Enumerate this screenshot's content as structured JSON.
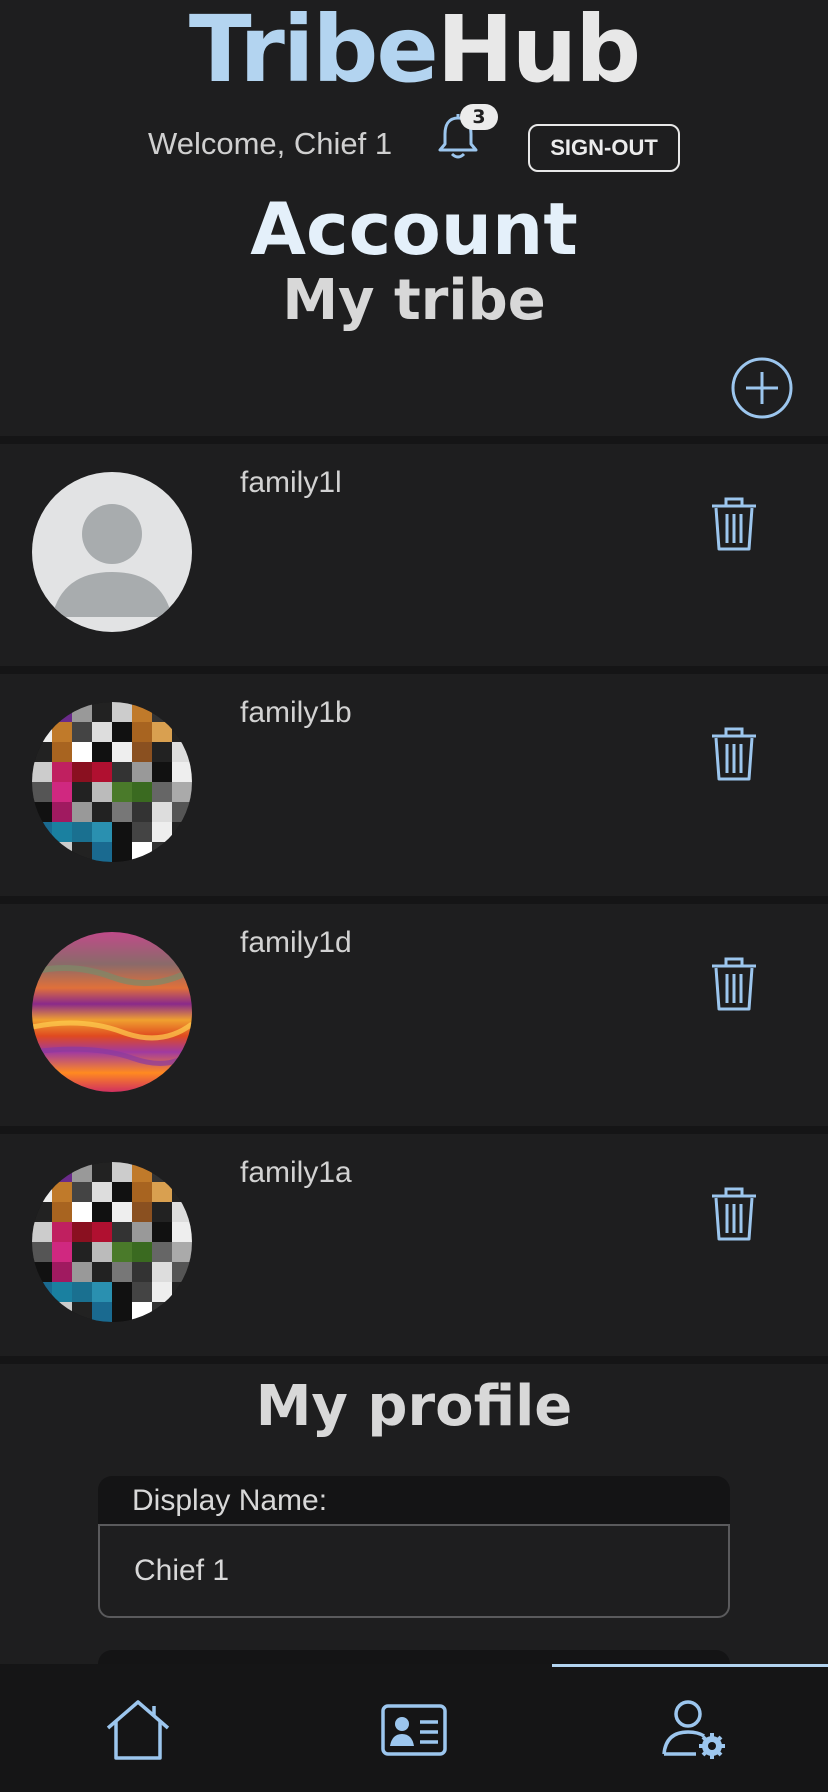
{
  "app": {
    "title_part1": "Tribe",
    "title_part2": "Hub"
  },
  "header": {
    "welcome": "Welcome, Chief 1",
    "notifications_count": "3",
    "signout_label": "SIGN-OUT"
  },
  "page": {
    "title": "Account",
    "tribe_heading": "My tribe",
    "profile_heading": "My profile"
  },
  "tribe": {
    "members": [
      {
        "name": "family1l",
        "avatar": "default-person"
      },
      {
        "name": "family1b",
        "avatar": "pixel-mosaic"
      },
      {
        "name": "family1d",
        "avatar": "sunset-swirl"
      },
      {
        "name": "family1a",
        "avatar": "pixel-mosaic"
      }
    ]
  },
  "profile": {
    "display_name_label": "Display Name:",
    "display_name_value": "Chief 1"
  },
  "nav": {
    "items": [
      {
        "icon": "home-icon"
      },
      {
        "icon": "contact-card-icon"
      },
      {
        "icon": "user-settings-icon",
        "active": true
      }
    ]
  },
  "colors": {
    "accent": "#b3d4f0",
    "background": "#1e1e1f"
  }
}
